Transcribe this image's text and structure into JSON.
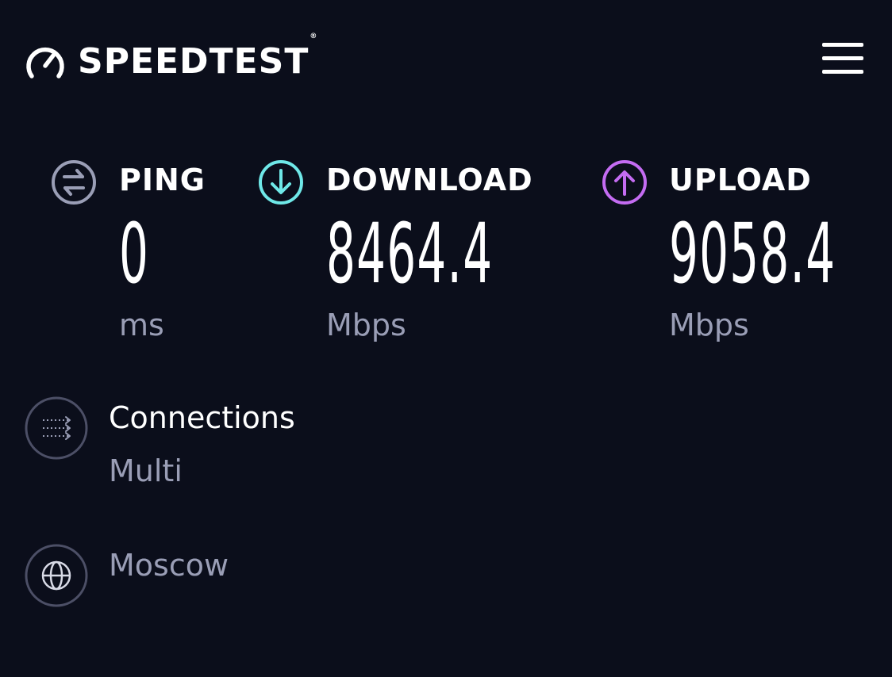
{
  "header": {
    "logo_text": "SPEEDTEST",
    "logo_mark": "®",
    "logo_icon": "speedometer-icon",
    "menu_icon": "hamburger-menu-icon"
  },
  "metrics": {
    "ping": {
      "label": "PING",
      "value": "0",
      "unit": "ms",
      "icon": "ping-arrows-icon",
      "color": "#9a9eb6"
    },
    "download": {
      "label": "DOWNLOAD",
      "value": "8464.4",
      "unit": "Mbps",
      "icon": "download-arrow-icon",
      "color": "#6fe8e8"
    },
    "upload": {
      "label": "UPLOAD",
      "value": "9058.4",
      "unit": "Mbps",
      "icon": "upload-arrow-icon",
      "color": "#c46cf2"
    }
  },
  "connections": {
    "title": "Connections",
    "value": "Multi",
    "icon": "connections-icon"
  },
  "server": {
    "location": "Moscow",
    "icon": "globe-icon"
  },
  "colors": {
    "background": "#0b0e1b",
    "text": "#ffffff",
    "muted": "#9a9eb6"
  }
}
